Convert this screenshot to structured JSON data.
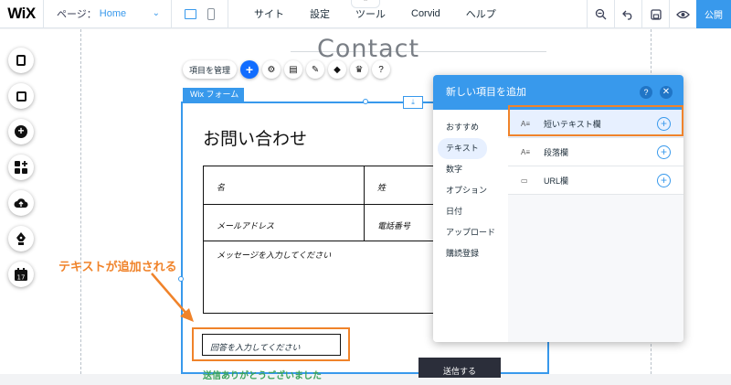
{
  "topbar": {
    "logo": "WiX",
    "page_label": "ページ：",
    "page_value": "Home",
    "notch": "⌃",
    "menus": [
      "サイト",
      "設定",
      "ツール",
      "Corvid",
      "ヘルプ"
    ],
    "publish": "公開"
  },
  "canvas": {
    "contact_title": "Contact",
    "manage_button": "項目を管理",
    "form_tag": "Wix フォーム"
  },
  "form": {
    "title": "お問い合わせ",
    "cells": [
      "名",
      "姓",
      "メールアドレス",
      "電話番号",
      "メッセージを入力してください"
    ],
    "answer_placeholder": "回答を入力してください",
    "thanks": "送信ありがとうございました",
    "submit": "送信する"
  },
  "annotation": "テキストが追加される",
  "panel": {
    "title": "新しい項目を追加",
    "help": "?",
    "close": "✕",
    "categories": [
      "おすすめ",
      "テキスト",
      "数字",
      "オプション",
      "日付",
      "アップロード",
      "購読登録"
    ],
    "active_category": 1,
    "items": [
      {
        "icon": "A≡",
        "label": "短いテキスト欄"
      },
      {
        "icon": "A≡",
        "label": "段落欄"
      },
      {
        "icon": "▭",
        "label": "URL欄"
      }
    ]
  },
  "colors": {
    "accent": "#3899ec",
    "highlight": "#f0832a",
    "success": "#3aa35a"
  }
}
